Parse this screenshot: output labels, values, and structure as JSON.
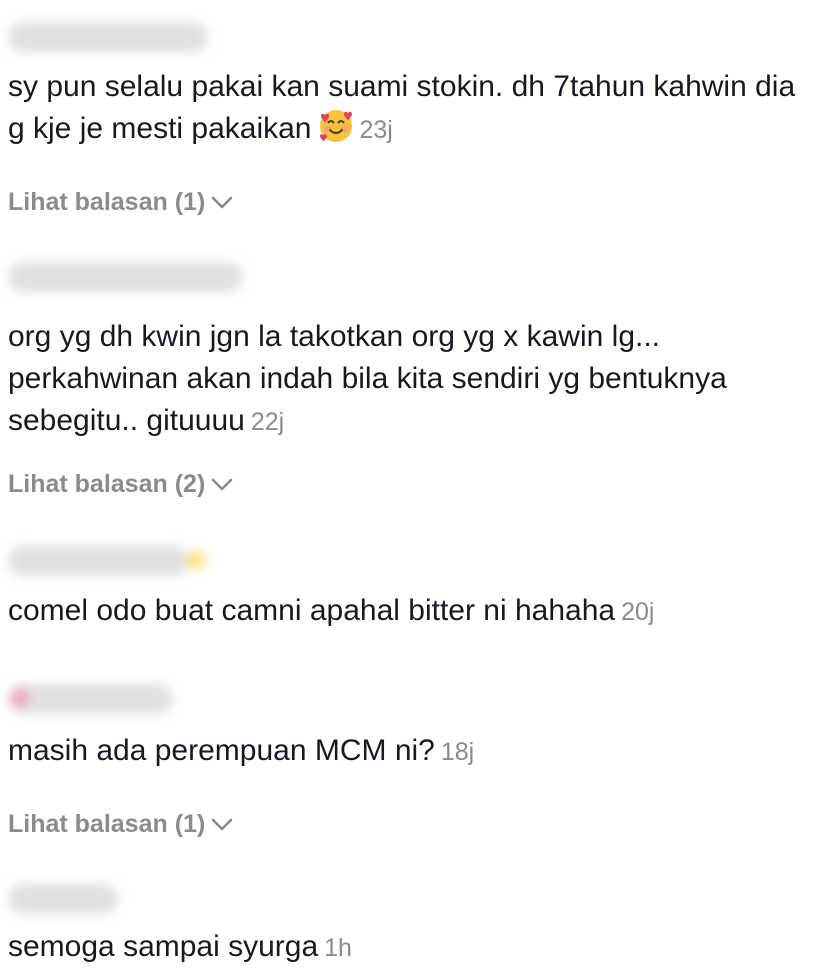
{
  "comments": [
    {
      "text": "sy pun selalu pakai kan suami stokin. dh 7tahun kahwin dia g kje je mesti pakaikan",
      "emoji": "smiling-face-with-hearts",
      "time": "23j",
      "replies": "Lihat balasan (1)"
    },
    {
      "text": "org yg dh kwin jgn la takotkan org yg x kawin lg... perkahwinan akan indah bila kita sendiri yg bentuknya sebegitu.. gituuuu",
      "time": "22j",
      "replies": "Lihat balasan (2)"
    },
    {
      "text": "comel odo buat camni apahal bitter ni hahaha",
      "time": "20j"
    },
    {
      "text": "masih ada perempuan MCM ni?",
      "time": "18j",
      "replies": "Lihat balasan (1)"
    },
    {
      "text": "semoga sampai syurga",
      "time": "1h"
    }
  ],
  "icons": {
    "replies_expand": "chevron-down-icon",
    "emoji": "smiling-face-with-hearts"
  },
  "colors": {
    "text": "#161823",
    "muted": "#8a8b91"
  }
}
